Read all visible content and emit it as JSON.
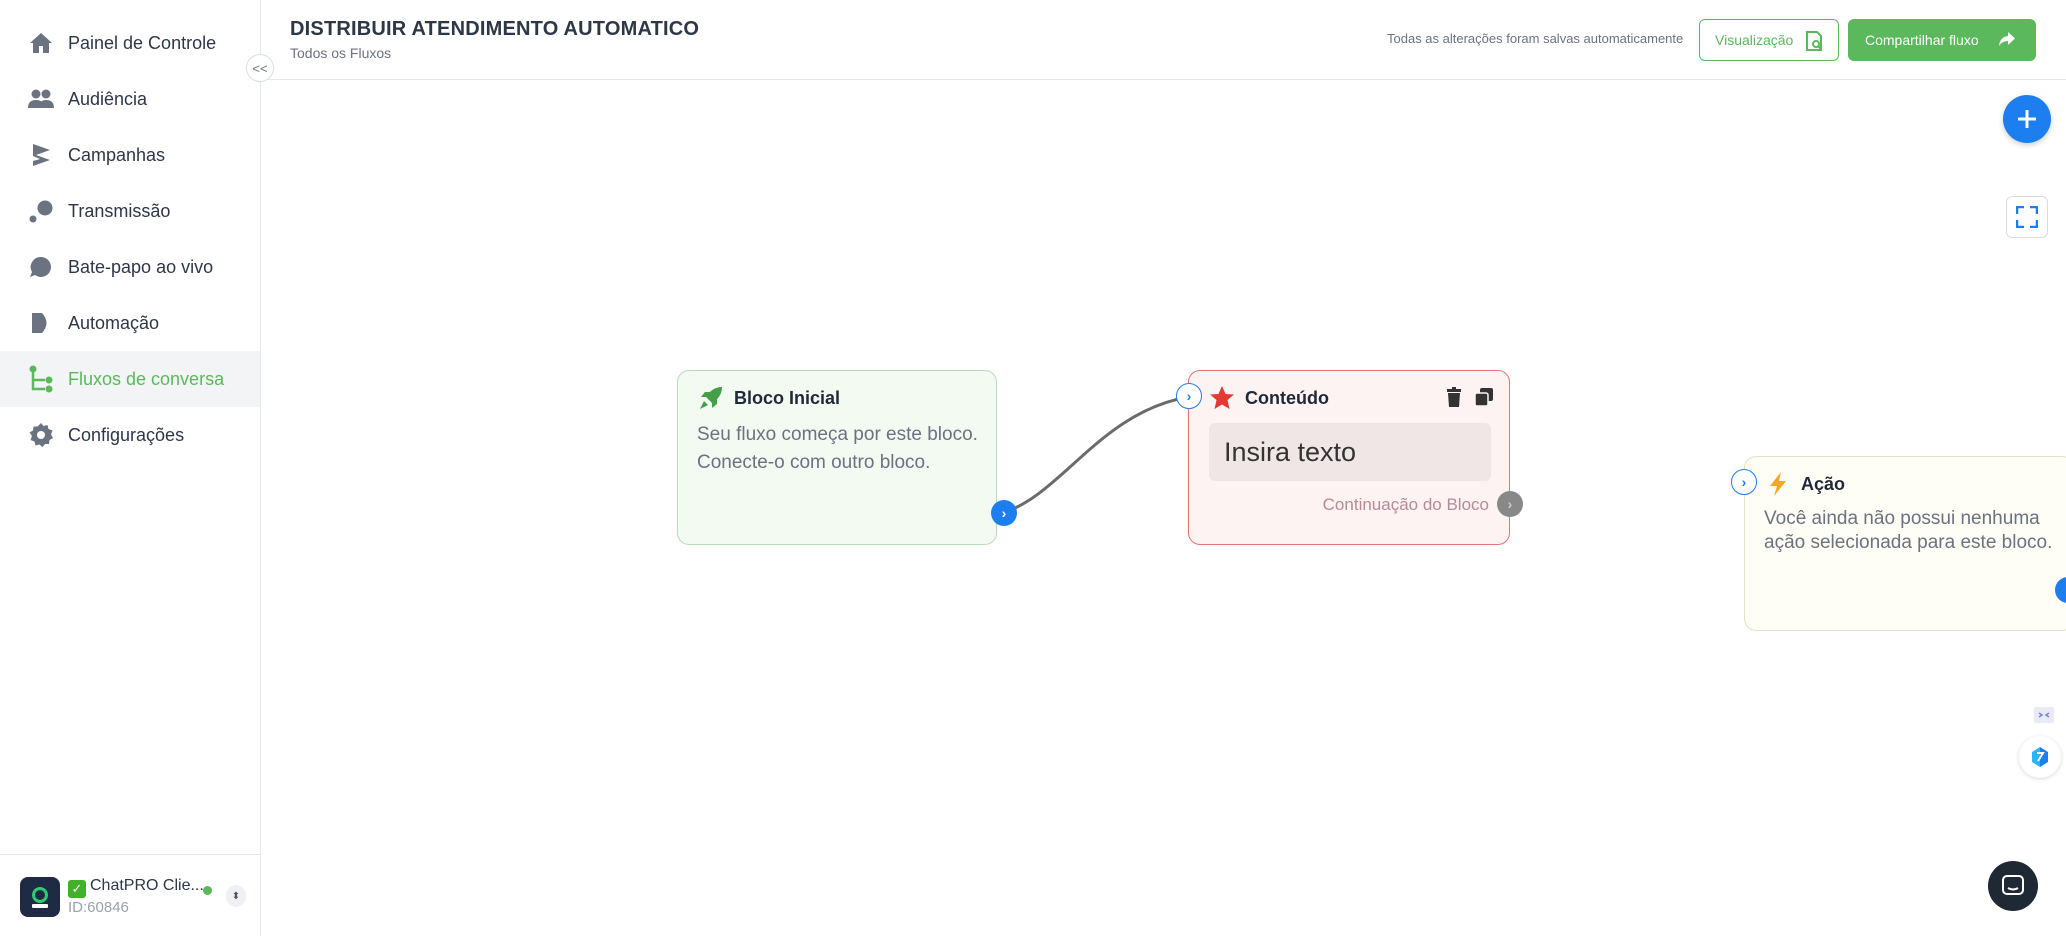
{
  "sidebar": {
    "items": [
      {
        "label": "Painel de Controle",
        "icon": "home-icon"
      },
      {
        "label": "Audiência",
        "icon": "users-icon"
      },
      {
        "label": "Campanhas",
        "icon": "campaign-icon"
      },
      {
        "label": "Transmissão",
        "icon": "broadcast-icon"
      },
      {
        "label": "Bate-papo ao vivo",
        "icon": "chat-bubble-icon"
      },
      {
        "label": "Automação",
        "icon": "automation-icon"
      },
      {
        "label": "Fluxos de conversa",
        "icon": "flow-icon",
        "active": true
      },
      {
        "label": "Configurações",
        "icon": "gear-icon"
      }
    ],
    "collapse_glyph": "<<",
    "account": {
      "name": "ChatPRO Clie...",
      "id": "ID:60846"
    }
  },
  "header": {
    "title": "DISTRIBUIR ATENDIMENTO AUTOMATICO",
    "breadcrumb": "Todos os Fluxos",
    "save_status": "Todas as alterações foram salvas automaticamente",
    "preview_label": "Visualização",
    "share_label": "Compartilhar fluxo"
  },
  "canvas": {
    "start_block": {
      "title": "Bloco Inicial",
      "description": "Seu fluxo começa por este bloco. Conecte-o com outro bloco."
    },
    "content_block": {
      "title": "Conteúdo",
      "text_placeholder": "Insira texto",
      "continuation": "Continuação do Bloco"
    },
    "action_block": {
      "title": "Ação",
      "description": "Você ainda não possui nenhuma ação selecionada para este bloco."
    }
  },
  "colors": {
    "brand_green": "#5cb85c",
    "accent_blue": "#1d7ef0",
    "content_border": "#e57373"
  }
}
